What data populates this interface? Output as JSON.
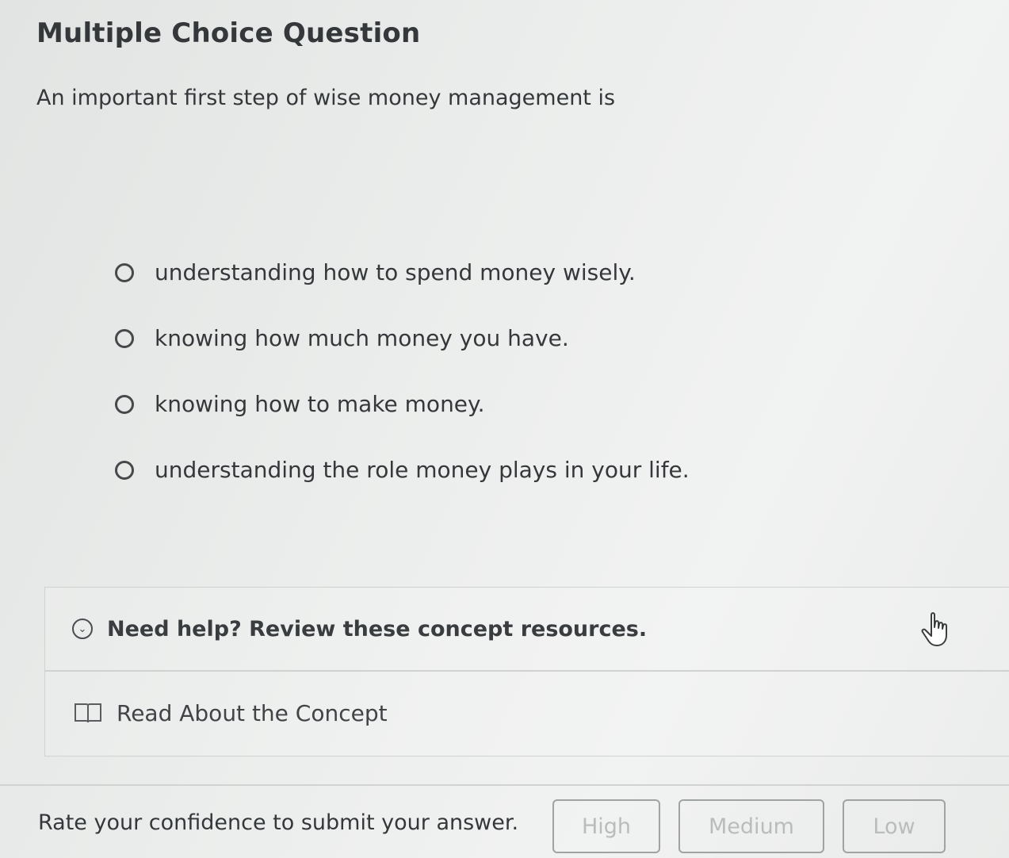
{
  "header": {
    "title": "Multiple Choice Question"
  },
  "question": {
    "text": "An important first step of wise money management is"
  },
  "options": [
    {
      "label": "understanding how to spend money wisely."
    },
    {
      "label": "knowing how much money you have."
    },
    {
      "label": "knowing how to make money."
    },
    {
      "label": "understanding the role money plays in your life."
    }
  ],
  "help": {
    "toggle_text": "Need help? Review these concept resources.",
    "resource_label": "Read About the Concept"
  },
  "confidence": {
    "prompt": "Rate your confidence to submit your answer.",
    "buttons": {
      "high": "High",
      "medium": "Medium",
      "low": "Low"
    }
  },
  "icons": {
    "toggle": "chevron-down-circle-icon",
    "resource": "book-icon",
    "cursor": "hand-pointer-icon"
  },
  "colors": {
    "text": "#35383b",
    "disabled_button_text": "#b9bcbc",
    "border": "#cfd2d1"
  }
}
